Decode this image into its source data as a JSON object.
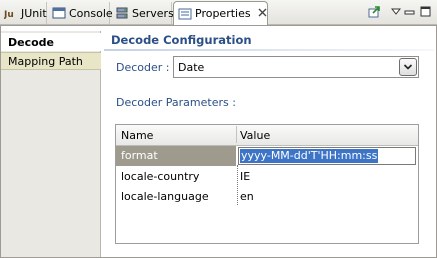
{
  "tabs": [
    {
      "label": "JUnit",
      "icon": "junit-icon"
    },
    {
      "label": "Console",
      "icon": "console-icon"
    },
    {
      "label": "Servers",
      "icon": "servers-icon"
    },
    {
      "label": "Properties",
      "icon": "properties-icon",
      "active": true
    }
  ],
  "toolbar": {
    "pin_icon": "pin-icon",
    "menu_icon": "view-menu-icon",
    "minimize_icon": "minimize-icon",
    "maximize_icon": "maximize-icon"
  },
  "sidebar": {
    "items": [
      {
        "label": "Decode",
        "selected": true
      },
      {
        "label": "Mapping Path",
        "selected": false
      }
    ]
  },
  "section": {
    "title": "Decode Configuration"
  },
  "decoder": {
    "label": "Decoder :",
    "value": "Date"
  },
  "parameters": {
    "label": "Decoder Parameters :",
    "columns": [
      "Name",
      "Value"
    ],
    "rows": [
      {
        "name": "format",
        "value": "yyyy-MM-dd'T'HH:mm:ss",
        "selected": true
      },
      {
        "name": "locale-country",
        "value": "IE"
      },
      {
        "name": "locale-language",
        "value": "en"
      }
    ]
  },
  "colors": {
    "section_title": "#2b4f87",
    "selection": "#3d74c6",
    "selected_row": "#9e9a8e"
  }
}
